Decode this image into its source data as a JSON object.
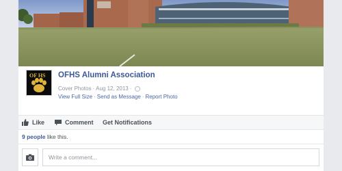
{
  "page": {
    "name": "OFHS Alumni Association",
    "album": "Cover Photos",
    "date": "Aug 12, 2013"
  },
  "photo_actions": [
    "View Full Size",
    "Send as Message",
    "Report Photo"
  ],
  "action_bar": {
    "like": "Like",
    "comment": "Comment",
    "notifications": "Get Notifications"
  },
  "likes": {
    "count": "9 people",
    "suffix": " like this."
  },
  "comment_box": {
    "placeholder": "Write a comment..."
  },
  "colors": {
    "link_blue": "#3b5998",
    "meta_gray": "#90949c",
    "logo_gold": "#e0b43a"
  },
  "icons": [
    "globe-icon",
    "like-icon",
    "comment-icon",
    "camera-icon",
    "paw-icon"
  ]
}
